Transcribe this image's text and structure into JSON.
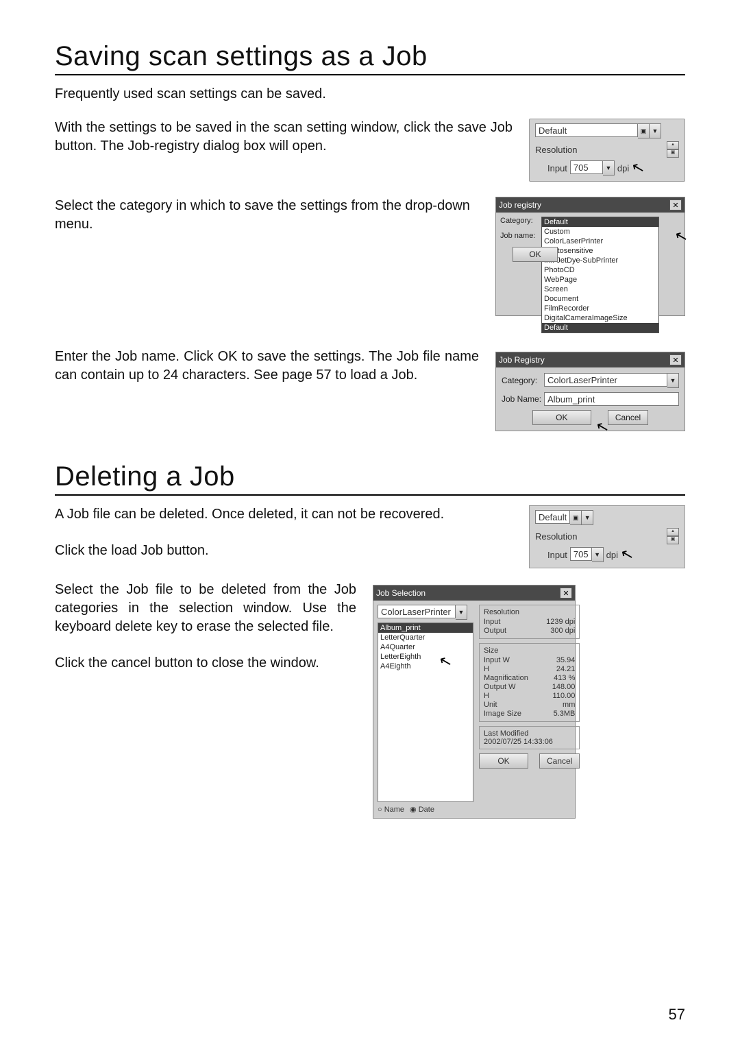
{
  "page_number": "57",
  "section1": {
    "title": "Saving scan settings as a Job",
    "p1": "Frequently used scan settings can be saved.",
    "p2": "With the settings to be saved in the scan setting window, click the save Job button. The Job-registry dialog box will open.",
    "p3": "Select the category in which to save the settings from the drop-down menu.",
    "p4": "Enter the Job name. Click OK to save the settings. The Job file name can contain up to 24 characters. See page 57 to load a Job."
  },
  "section2": {
    "title": "Deleting a Job",
    "p1": "A Job file can be deleted. Once deleted, it can not be recovered.",
    "p2": "Click the load Job button.",
    "p3": "Select the Job file to be deleted from the Job categories in the selection window. Use the keyboard delete key to erase the selected file.",
    "p4": "Click the cancel button to close the window."
  },
  "figA": {
    "category": "Default",
    "res_label": "Resolution",
    "input_label": "Input",
    "input_value": "705",
    "unit": "dpi"
  },
  "figB": {
    "title": "Job registry",
    "cat_label": "Category:",
    "name_label": "Job name:",
    "ok": "OK",
    "options": [
      "Default",
      "Custom",
      "ColorLaserPrinter",
      "Photosensitive",
      "Ink-JetDye-SubPrinter",
      "PhotoCD",
      "WebPage",
      "Screen",
      "Document",
      "FilmRecorder",
      "DigitalCameraImageSize",
      "Default"
    ]
  },
  "figC": {
    "title": "Job Registry",
    "cat_label": "Category:",
    "cat_value": "ColorLaserPrinter",
    "name_label": "Job Name:",
    "name_value": "Album_print",
    "ok": "OK",
    "cancel": "Cancel"
  },
  "figD": {
    "category": "Default",
    "res_label": "Resolution",
    "input_label": "Input",
    "input_value": "705",
    "unit": "dpi"
  },
  "figE": {
    "title": "Job Selection",
    "cat_value": "ColorLaserPrinter",
    "jobs": [
      "Album_print",
      "LetterQuarter",
      "A4Quarter",
      "LetterEighth",
      "A4Eighth"
    ],
    "sort_name": "Name",
    "sort_date": "Date",
    "ok": "OK",
    "cancel": "Cancel",
    "grp_resolution": {
      "title": "Resolution",
      "input_l": "Input",
      "input_v": "1239",
      "input_u": "dpi",
      "output_l": "Output",
      "output_v": "300",
      "output_u": "dpi"
    },
    "grp_size": {
      "title": "Size",
      "iw_l": "Input W",
      "iw_v": "35.94",
      "ih_l": "H",
      "ih_v": "24.21",
      "mag_l": "Magnification",
      "mag_v": "413",
      "mag_u": "%",
      "ow_l": "Output W",
      "ow_v": "148.00",
      "oh_l": "H",
      "oh_v": "110.00",
      "unit_l": "Unit",
      "unit_v": "mm",
      "is_l": "Image Size",
      "is_v": "5.3MB"
    },
    "grp_mod": {
      "title": "Last Modified",
      "val": "2002/07/25  14:33:06"
    }
  }
}
